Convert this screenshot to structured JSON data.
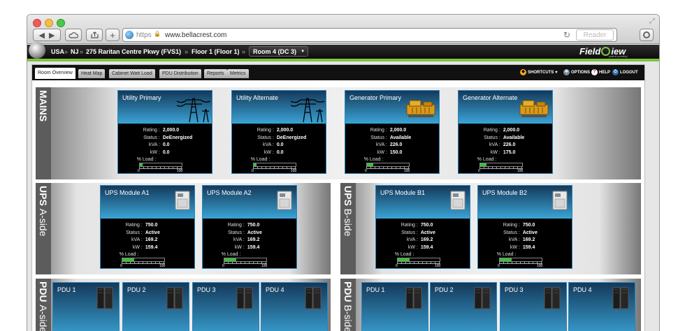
{
  "browser": {
    "protocol": "https",
    "url": "www.bellacrest.com",
    "reader_label": "Reader"
  },
  "app": {
    "breadcrumb": [
      "USA",
      "NJ",
      "275 Raritan Centre Pkwy (FVS1)",
      "Floor 1 (Floor 1)",
      "Room 4 (DC 3)"
    ],
    "logo_prefix": "Field",
    "logo_suffix": "iew",
    "logo_tagline": "patent pending"
  },
  "tabs": [
    "Room Overview",
    "Heat Map",
    "Cabinet Watt Load",
    "PDU Distribution",
    "Reports",
    "Metrics"
  ],
  "controls": {
    "shortcuts": "SHORTCUTS",
    "options": "OPTIONS",
    "help": "HELP",
    "logout": "LOGOUT"
  },
  "labels": {
    "rating": "Rating :",
    "status": "Status :",
    "kva": "kVA :",
    "kw": "kW :",
    "load": "% Load :",
    "scale_min": "0",
    "scale_max": "100"
  },
  "sections": {
    "mains": {
      "title_bold": "MAINS",
      "title_rest": ""
    },
    "ups_a": {
      "title_bold": "UPS",
      "title_rest": "A-side"
    },
    "ups_b": {
      "title_bold": "UPS",
      "title_rest": "B-side"
    },
    "pdu_a": {
      "title_bold": "PDU",
      "title_rest": "A-side"
    },
    "pdu_b": {
      "title_bold": "PDU",
      "title_rest": "B-side"
    }
  },
  "mains": [
    {
      "name": "Utility Primary",
      "rating": "2,000.0",
      "status": "DeEnergized",
      "kva": "0.0",
      "kw": "0.0",
      "load": 0.0
    },
    {
      "name": "Utility Alternate",
      "rating": "2,000.0",
      "status": "DeEnergized",
      "kva": "0.0",
      "kw": "0.0",
      "load": 0.0
    },
    {
      "name": "Generator Primary",
      "rating": "2,000.0",
      "status": "Available",
      "kva": "226.0",
      "kw": "150.0",
      "load": 7.5
    },
    {
      "name": "Generator Alternate",
      "rating": "2,000.0",
      "status": "Available",
      "kva": "226.0",
      "kw": "175.0",
      "load": 8.8
    }
  ],
  "ups": [
    {
      "name": "UPS Module A1",
      "rating": "750.0",
      "status": "Active",
      "kva": "169.2",
      "kw": "159.4",
      "load": 21
    },
    {
      "name": "UPS Module A2",
      "rating": "750.0",
      "status": "Active",
      "kva": "169.2",
      "kw": "159.4",
      "load": 21
    },
    {
      "name": "UPS Module B1",
      "rating": "750.0",
      "status": "Active",
      "kva": "169.2",
      "kw": "159.4",
      "load": 21
    },
    {
      "name": "UPS Module B2",
      "rating": "750.0",
      "status": "Active",
      "kva": "169.2",
      "kw": "159.4",
      "load": 21
    }
  ],
  "pdu": [
    {
      "name": "PDU 1"
    },
    {
      "name": "PDU 2"
    },
    {
      "name": "PDU 3"
    },
    {
      "name": "PDU 4"
    },
    {
      "name": "PDU 1"
    },
    {
      "name": "PDU 2"
    },
    {
      "name": "PDU 3"
    },
    {
      "name": "PDU 4"
    }
  ]
}
